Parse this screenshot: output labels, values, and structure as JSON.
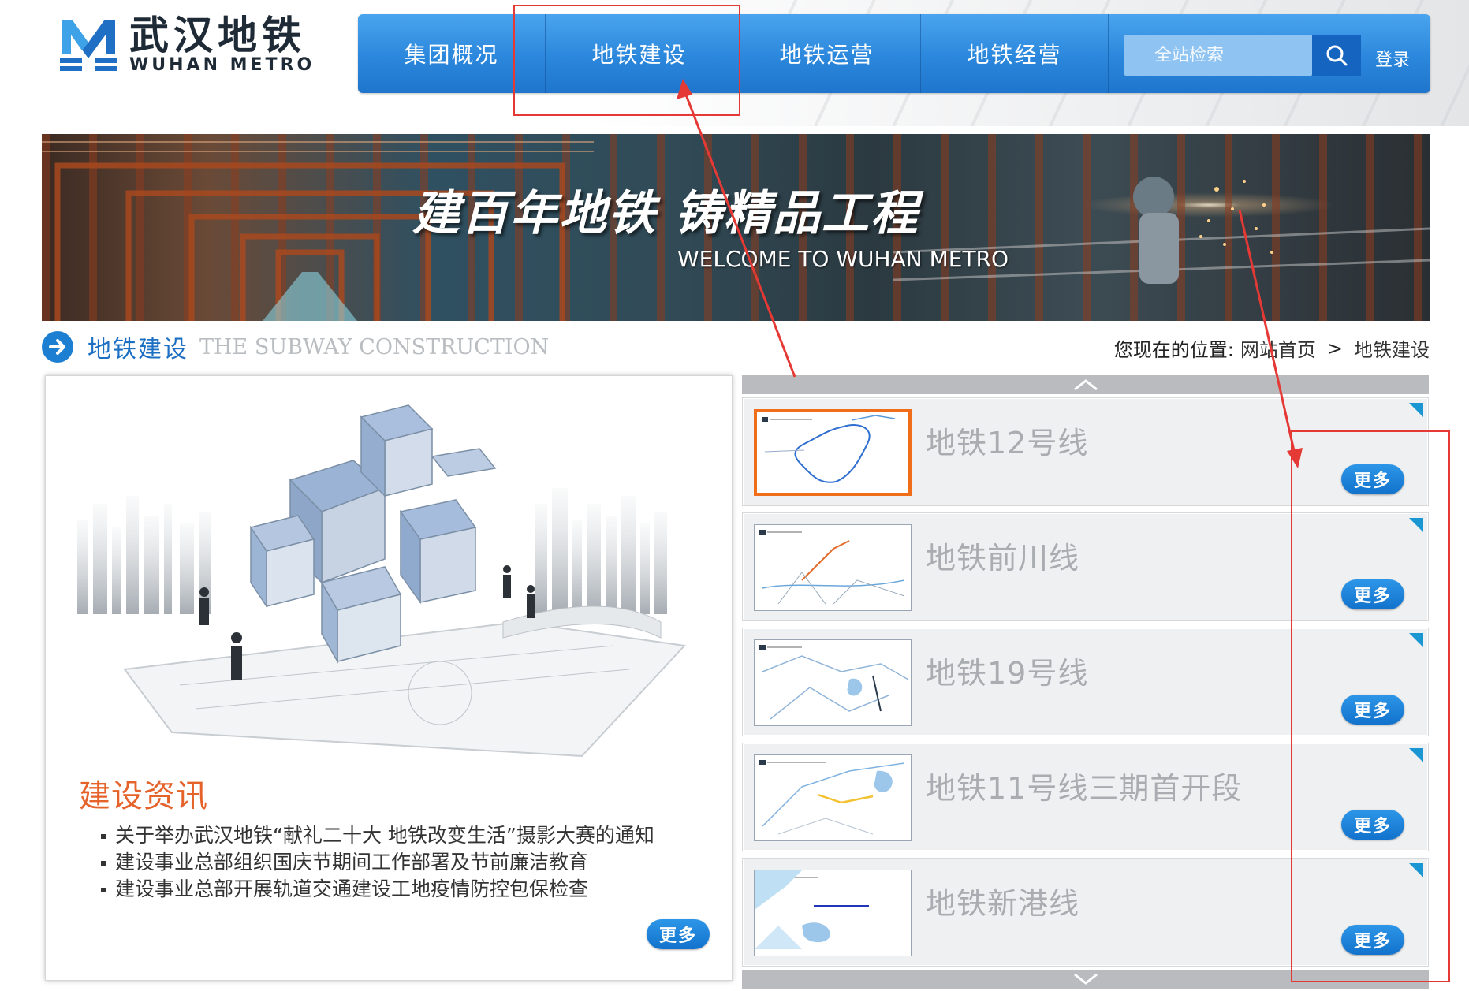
{
  "header": {
    "logo_cn": "武汉地铁",
    "logo_en": "WUHAN METRO",
    "nav": [
      "集团概况",
      "地铁建设",
      "地铁运营",
      "地铁经营"
    ],
    "search_placeholder": "全站检索",
    "login": "登录"
  },
  "banner": {
    "slogan": "建百年地铁  铸精品工程",
    "subtitle": "WELCOME TO WUHAN METRO"
  },
  "section": {
    "title_cn": "地铁建设",
    "title_en": "THE SUBWAY CONSTRUCTION"
  },
  "breadcrumb": {
    "label": "您现在的位置:",
    "home": "网站首页",
    "separator": ">",
    "current": "地铁建设"
  },
  "news": {
    "title": "建设资讯",
    "items": [
      "关于举办武汉地铁“献礼二十大 地铁改变生活”摄影大赛的通知",
      "建设事业总部组织国庆节期间工作部署及节前廉洁教育",
      "建设事业总部开展轨道交通建设工地疫情防控包保检查"
    ],
    "more": "更多"
  },
  "lines": [
    {
      "name": "地铁12号线",
      "more": "更多",
      "active": true
    },
    {
      "name": "地铁前川线",
      "more": "更多",
      "active": false
    },
    {
      "name": "地铁19号线",
      "more": "更多",
      "active": false
    },
    {
      "name": "地铁11号线三期首开段",
      "more": "更多",
      "active": false
    },
    {
      "name": "地铁新港线",
      "more": "更多",
      "active": false
    }
  ],
  "colors": {
    "nav_blue": "#2b87dc",
    "accent_orange": "#e5632a",
    "annotation_red": "#e53935",
    "corner_teal": "#1a96d2"
  }
}
